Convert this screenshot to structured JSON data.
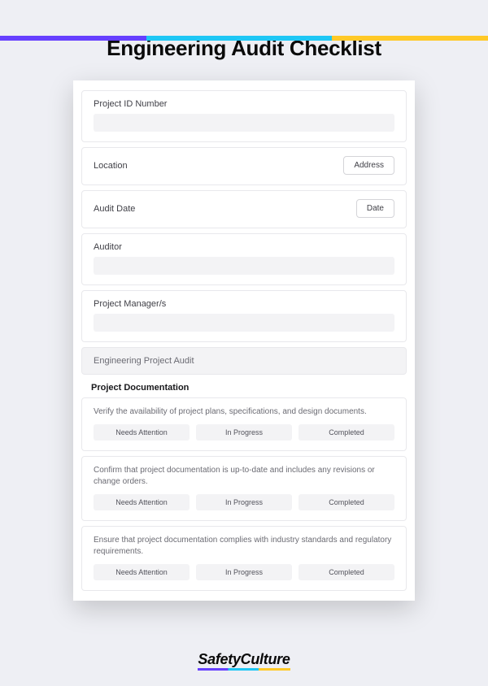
{
  "title": "Engineering Audit Checklist",
  "fields": {
    "project_id": {
      "label": "Project ID Number"
    },
    "location": {
      "label": "Location",
      "chip": "Address"
    },
    "audit_date": {
      "label": "Audit Date",
      "chip": "Date"
    },
    "auditor": {
      "label": "Auditor"
    },
    "project_managers": {
      "label": "Project Manager/s"
    }
  },
  "section_banner": "Engineering Project Audit",
  "subsection": "Project Documentation",
  "status_options": [
    "Needs Attention",
    "In Progress",
    "Completed"
  ],
  "questions": [
    "Verify the availability of project plans, specifications, and design documents.",
    "Confirm that project documentation is up-to-date and includes any revisions or change orders.",
    "Ensure that project documentation complies with industry standards and regulatory requirements."
  ],
  "brand": "SafetyCulture"
}
